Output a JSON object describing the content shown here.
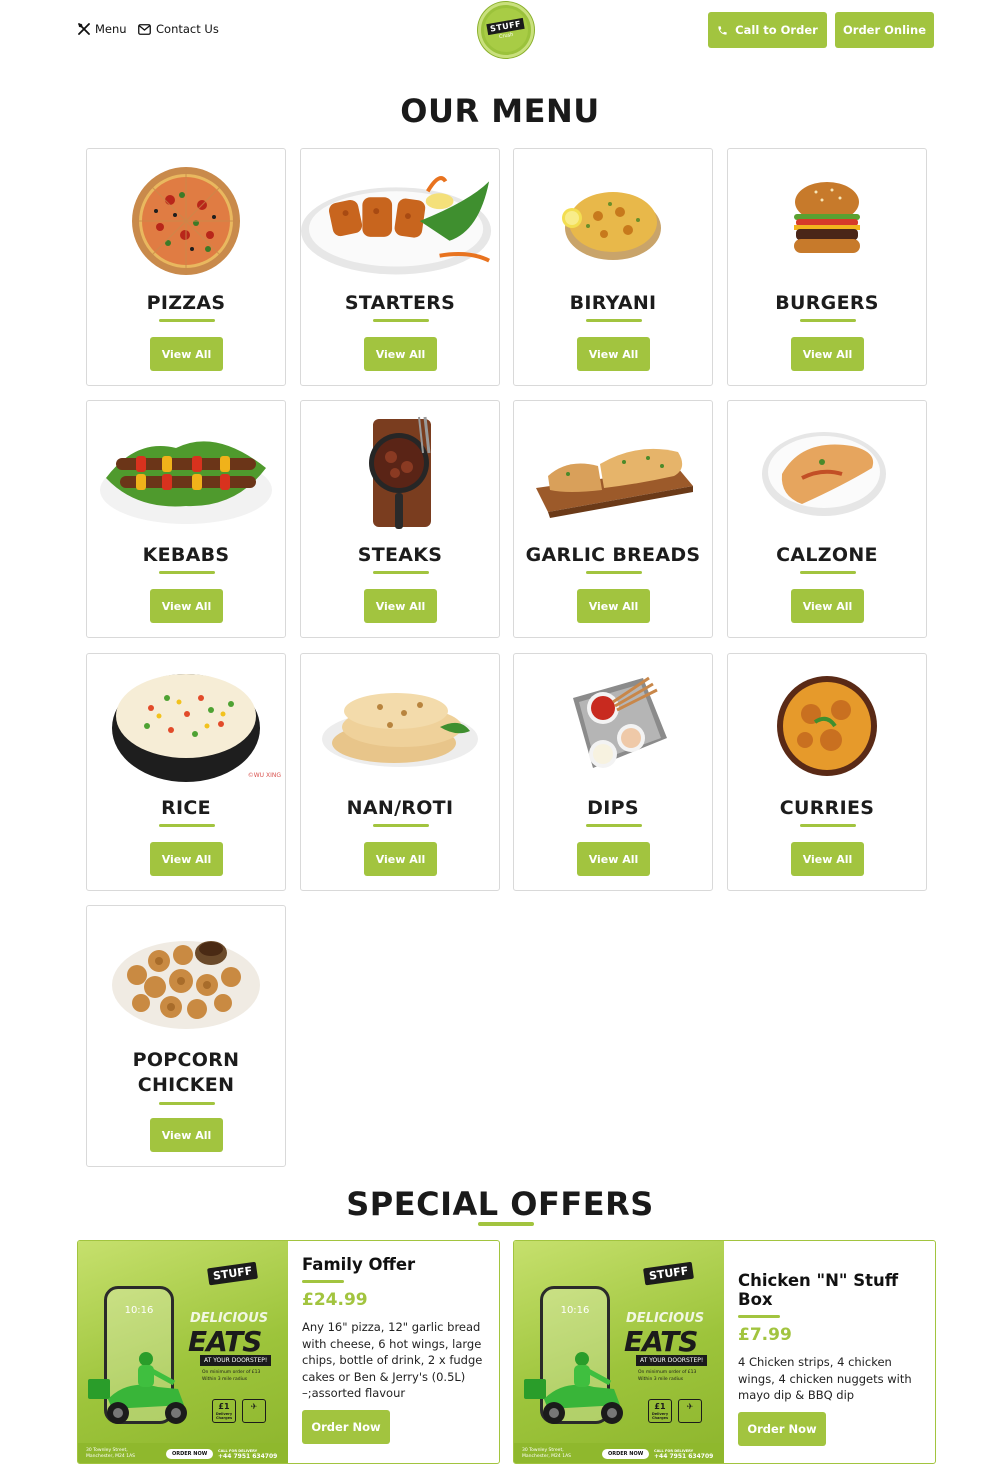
{
  "header": {
    "menu_label": "Menu",
    "contact_label": "Contact Us",
    "logo_text": "STUFF",
    "logo_sub": "Crush",
    "call_label": "Call to Order",
    "order_label": "Order Online"
  },
  "menu_section": {
    "title": "OUR MENU",
    "button_label": "View All",
    "items": [
      {
        "title": "PIZZAS",
        "icon": "pizza-image"
      },
      {
        "title": "STARTERS",
        "icon": "starters-image"
      },
      {
        "title": "BIRYANI",
        "icon": "biryani-image"
      },
      {
        "title": "BURGERS",
        "icon": "burger-image"
      },
      {
        "title": "KEBABS",
        "icon": "kebab-image"
      },
      {
        "title": "STEAKS",
        "icon": "steak-image"
      },
      {
        "title": "GARLIC BREADS",
        "icon": "garlic-bread-image"
      },
      {
        "title": "CALZONE",
        "icon": "calzone-image"
      },
      {
        "title": "RICE",
        "icon": "rice-image",
        "watermark": "©WU XING"
      },
      {
        "title": "NAN/ROTI",
        "icon": "naan-image"
      },
      {
        "title": "DIPS",
        "icon": "dips-image"
      },
      {
        "title": "CURRIES",
        "icon": "curry-image"
      },
      {
        "title": "POPCORN CHICKEN",
        "icon": "popcorn-chicken-image"
      }
    ]
  },
  "offers_section": {
    "title": "SPECIAL OFFERS",
    "button_label": "Order Now",
    "promo": {
      "logo": "STUFF",
      "delicious": "DELICIOUS",
      "eats": "EATS",
      "doorstep": "AT YOUR DOORSTEP!",
      "bullet_1": "On minimum order of £13",
      "bullet_2": "Within 3 mile radius",
      "box_1_big": "£1",
      "box_1_small": "Delivery Charges",
      "address": "30 Townley Street, Manchester, M24 1AS",
      "order_now": "ORDER NOW",
      "phone": "+44 7951 634709",
      "phone_label": "CALL FOR DELIVERY",
      "phone_time": "10:16"
    },
    "offers": [
      {
        "title": "Family Offer",
        "price": "£24.99",
        "description": "Any 16\" pizza, 12\" garlic bread with cheese, 6 hot wings, large chips, bottle of drink, 2 x fudge cakes or Ben & Jerry's (0.5L) –;assorted flavour"
      },
      {
        "title": "Chicken \"N\" Stuff Box",
        "price": "£7.99",
        "description": "4 Chicken strips, 4 chicken wings, 4 chicken nuggets with mayo dip & BBQ dip"
      }
    ]
  },
  "colors": {
    "accent": "#a2c43f",
    "text": "#1c1c1c",
    "border": "#d9d9d9"
  }
}
